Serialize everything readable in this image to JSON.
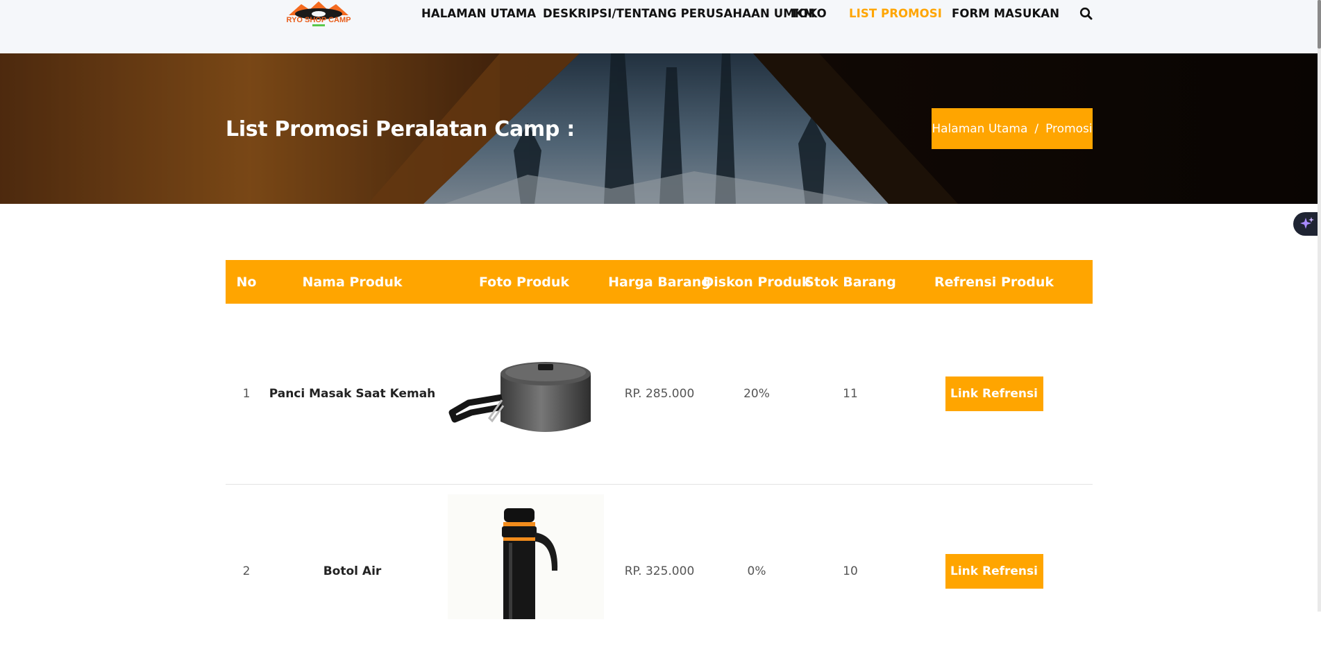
{
  "colors": {
    "accent": "#ffa500",
    "nav_text": "#111111",
    "header_bg": "#f5f7fa"
  },
  "header": {
    "logo_text": "RYO SHOP CAMP",
    "nav": [
      {
        "label": "HALAMAN UTAMA",
        "active": false
      },
      {
        "label": "DESKRIPSI/TENTANG PERUSAHAAN UMKM",
        "active": false
      },
      {
        "label": "TOKO",
        "active": false
      },
      {
        "label": "LIST PROMOSI",
        "active": true
      },
      {
        "label": "FORM MASUKAN",
        "active": false
      }
    ],
    "search_icon": "search-icon"
  },
  "hero": {
    "title": "List Promosi Peralatan Camp :",
    "breadcrumb": {
      "home": "Halaman Utama",
      "separator": "/",
      "current": "Promosi"
    }
  },
  "table": {
    "columns": [
      "No",
      "Nama Produk",
      "Foto Produk",
      "Harga Barang",
      "Diskon Produk",
      "Stok Barang",
      "Refrensi Produk"
    ],
    "rows": [
      {
        "no": "1",
        "name": "Panci Masak Saat Kemah",
        "photo": "cooking-pot",
        "price": "RP. 285.000",
        "discount": "20%",
        "stock": "11",
        "link_label": "Link Refrensi"
      },
      {
        "no": "2",
        "name": "Botol Air",
        "photo": "thermos-bottle",
        "price": "RP. 325.000",
        "discount": "0%",
        "stock": "10",
        "link_label": "Link Refrensi"
      }
    ]
  },
  "floating_button_icon": "sparkle-icon"
}
